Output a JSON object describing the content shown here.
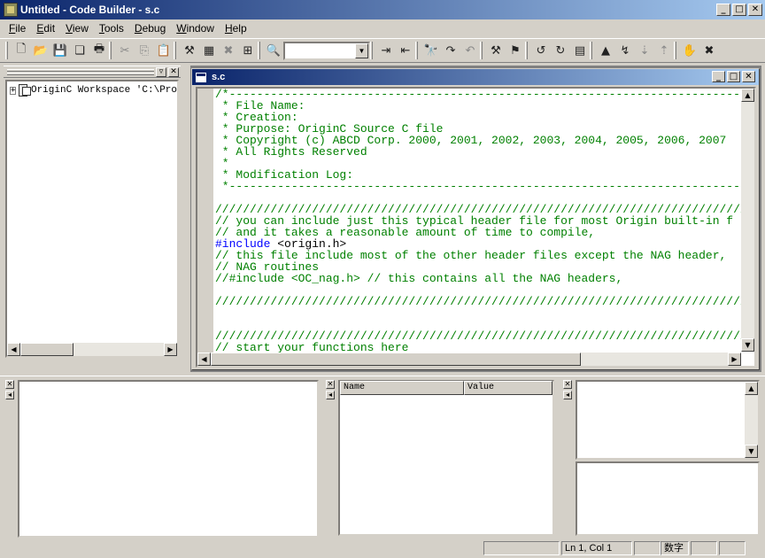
{
  "window": {
    "title": "Untitled - Code Builder - s.c",
    "min": "_",
    "max": "□",
    "close": "✕"
  },
  "menu": [
    {
      "label": "File",
      "key": "F",
      "rest": "ile"
    },
    {
      "label": "Edit",
      "key": "E",
      "rest": "dit"
    },
    {
      "label": "View",
      "key": "V",
      "rest": "iew"
    },
    {
      "label": "Tools",
      "key": "T",
      "rest": "ools"
    },
    {
      "label": "Debug",
      "key": "D",
      "rest": "ebug"
    },
    {
      "label": "Window",
      "key": "W",
      "rest": "indow"
    },
    {
      "label": "Help",
      "key": "H",
      "rest": "elp"
    }
  ],
  "toolbar": {
    "groups": [
      [
        "new-file-icon",
        "open-folder-icon",
        "save-icon",
        "save-all-icon",
        "print-icon"
      ],
      [
        "cut-icon",
        "copy-icon",
        "paste-icon"
      ],
      [
        "build-icon",
        "build-all-icon",
        "clean-icon",
        "rebuild-icon"
      ],
      [
        "find-in-files-icon"
      ],
      [
        "indent-icon",
        "outdent-icon"
      ],
      [
        "find-icon",
        "find-next-icon",
        "find-previous-icon"
      ],
      [
        "breakpoint-icon",
        "toggle-breakpoint-icon"
      ],
      [
        "undo-icon",
        "redo-icon",
        "bookmark-icon"
      ],
      [
        "go-icon",
        "step-over-icon",
        "step-into-icon",
        "step-out-icon"
      ],
      [
        "hand-icon",
        "stop-icon"
      ]
    ],
    "glyphs": {
      "new-file-icon": "🗋",
      "open-folder-icon": "📂",
      "save-icon": "💾",
      "save-all-icon": "❏",
      "print-icon": "🖶",
      "cut-icon": "✂",
      "copy-icon": "⎘",
      "paste-icon": "📋",
      "build-icon": "⚒",
      "build-all-icon": "▦",
      "clean-icon": "✖",
      "rebuild-icon": "⊞",
      "find-in-files-icon": "🔍",
      "indent-icon": "⇥",
      "outdent-icon": "⇤",
      "find-icon": "🔭",
      "find-next-icon": "↷",
      "find-previous-icon": "↶",
      "breakpoint-icon": "⚒",
      "toggle-breakpoint-icon": "⚑",
      "undo-icon": "↺",
      "redo-icon": "↻",
      "bookmark-icon": "▤",
      "go-icon": "▲",
      "step-over-icon": "↯",
      "step-into-icon": "⇣",
      "step-out-icon": "⇡",
      "hand-icon": "✋",
      "stop-icon": "✖"
    },
    "combo_value": ""
  },
  "workspace": {
    "tree_label": "OriginC Workspace 'C:\\Pro",
    "expander": "+"
  },
  "editor": {
    "title": "s.c",
    "lines": [
      {
        "text": "/*-------------------------------------------------------------------------------",
        "kind": "comment"
      },
      {
        "text": " * File Name:",
        "kind": "comment"
      },
      {
        "text": " * Creation:",
        "kind": "comment"
      },
      {
        "text": " * Purpose: OriginC Source C file",
        "kind": "comment"
      },
      {
        "text": " * Copyright (c) ABCD Corp. 2000, 2001, 2002, 2003, 2004, 2005, 2006, 2007",
        "kind": "comment"
      },
      {
        "text": " * All Rights Reserved",
        "kind": "comment"
      },
      {
        "text": " *",
        "kind": "comment"
      },
      {
        "text": " * Modification Log:",
        "kind": "comment"
      },
      {
        "text": " *-------------------------------------------------------------------------------",
        "kind": "comment"
      },
      {
        "text": "",
        "kind": "comment"
      },
      {
        "text": "////////////////////////////////////////////////////////////////////////////////",
        "kind": "comment"
      },
      {
        "text": "// you can include just this typical header file for most Origin built-in f",
        "kind": "comment"
      },
      {
        "text": "// and it takes a reasonable amount of time to compile,",
        "kind": "comment"
      },
      {
        "text": "#include <origin.h>",
        "kind": "include"
      },
      {
        "text": "// this file include most of the other header files except the NAG header,",
        "kind": "comment"
      },
      {
        "text": "// NAG routines",
        "kind": "comment"
      },
      {
        "text": "//#include <OC_nag.h> // this contains all the NAG headers,",
        "kind": "comment"
      },
      {
        "text": "",
        "kind": "comment"
      },
      {
        "text": "////////////////////////////////////////////////////////////////////////////////",
        "kind": "comment"
      },
      {
        "text": "",
        "kind": "comment"
      },
      {
        "text": "",
        "kind": "comment"
      },
      {
        "text": "////////////////////////////////////////////////////////////////////////////////",
        "kind": "comment"
      },
      {
        "text": "// start your functions here",
        "kind": "comment"
      }
    ]
  },
  "variables": {
    "col_name": "Name",
    "col_value": "Value"
  },
  "statusbar": {
    "position": "Ln 1, Col 1",
    "mode": "数字"
  },
  "colors": {
    "title_active": "#0a246a",
    "comment": "#008000",
    "preprocessor": "#0000ff"
  }
}
